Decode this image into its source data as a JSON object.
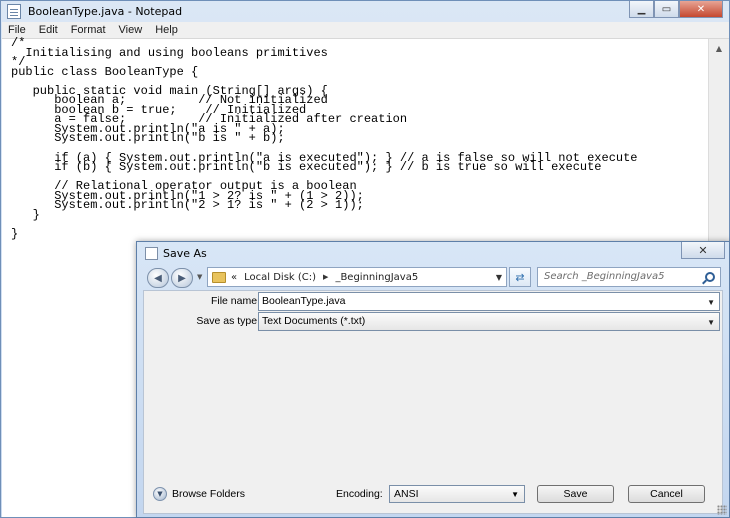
{
  "notepad": {
    "title": "BooleanType.java - Notepad",
    "menu": [
      "File",
      "Edit",
      "Format",
      "View",
      "Help"
    ],
    "content": "/*\n  Initialising and using booleans primitives\n*/\npublic class BooleanType {\n\n   public static void main (String[] args) {\n      boolean a;          // Not initialized\n      boolean b = true;    // Initialized\n      a = false;          // Initialized after creation\n      System.out.println(\"a is \" + a);\n      System.out.println(\"b is \" + b);\n\n      if (a) { System.out.println(\"a is executed\"); } // a is false so will not execute\n      if (b) { System.out.println(\"b is executed\"); } // b is true so will execute\n\n      // Relational operator output is a boolean\n      System.out.println(\"1 > 2? is \" + (1 > 2));\n      System.out.println(\"2 > 1? is \" + (2 > 1));\n   }\n\n}",
    "caption_icons": [
      "minimize-icon",
      "maximize-icon",
      "close-icon"
    ]
  },
  "save_dialog": {
    "title": "Save As",
    "address_crumbs": [
      "«",
      "Local Disk (C:)",
      "_BeginningJava5"
    ],
    "search_placeholder": "Search _BeginningJava5",
    "file_name_label": "File name:",
    "file_name_value": "BooleanType.java",
    "save_type_label": "Save as type:",
    "save_type_value": "Text Documents (*.txt)",
    "browse_folders_label": "Browse Folders",
    "encoding_label": "Encoding:",
    "encoding_value": "ANSI",
    "save_button": "Save",
    "cancel_button": "Cancel"
  }
}
